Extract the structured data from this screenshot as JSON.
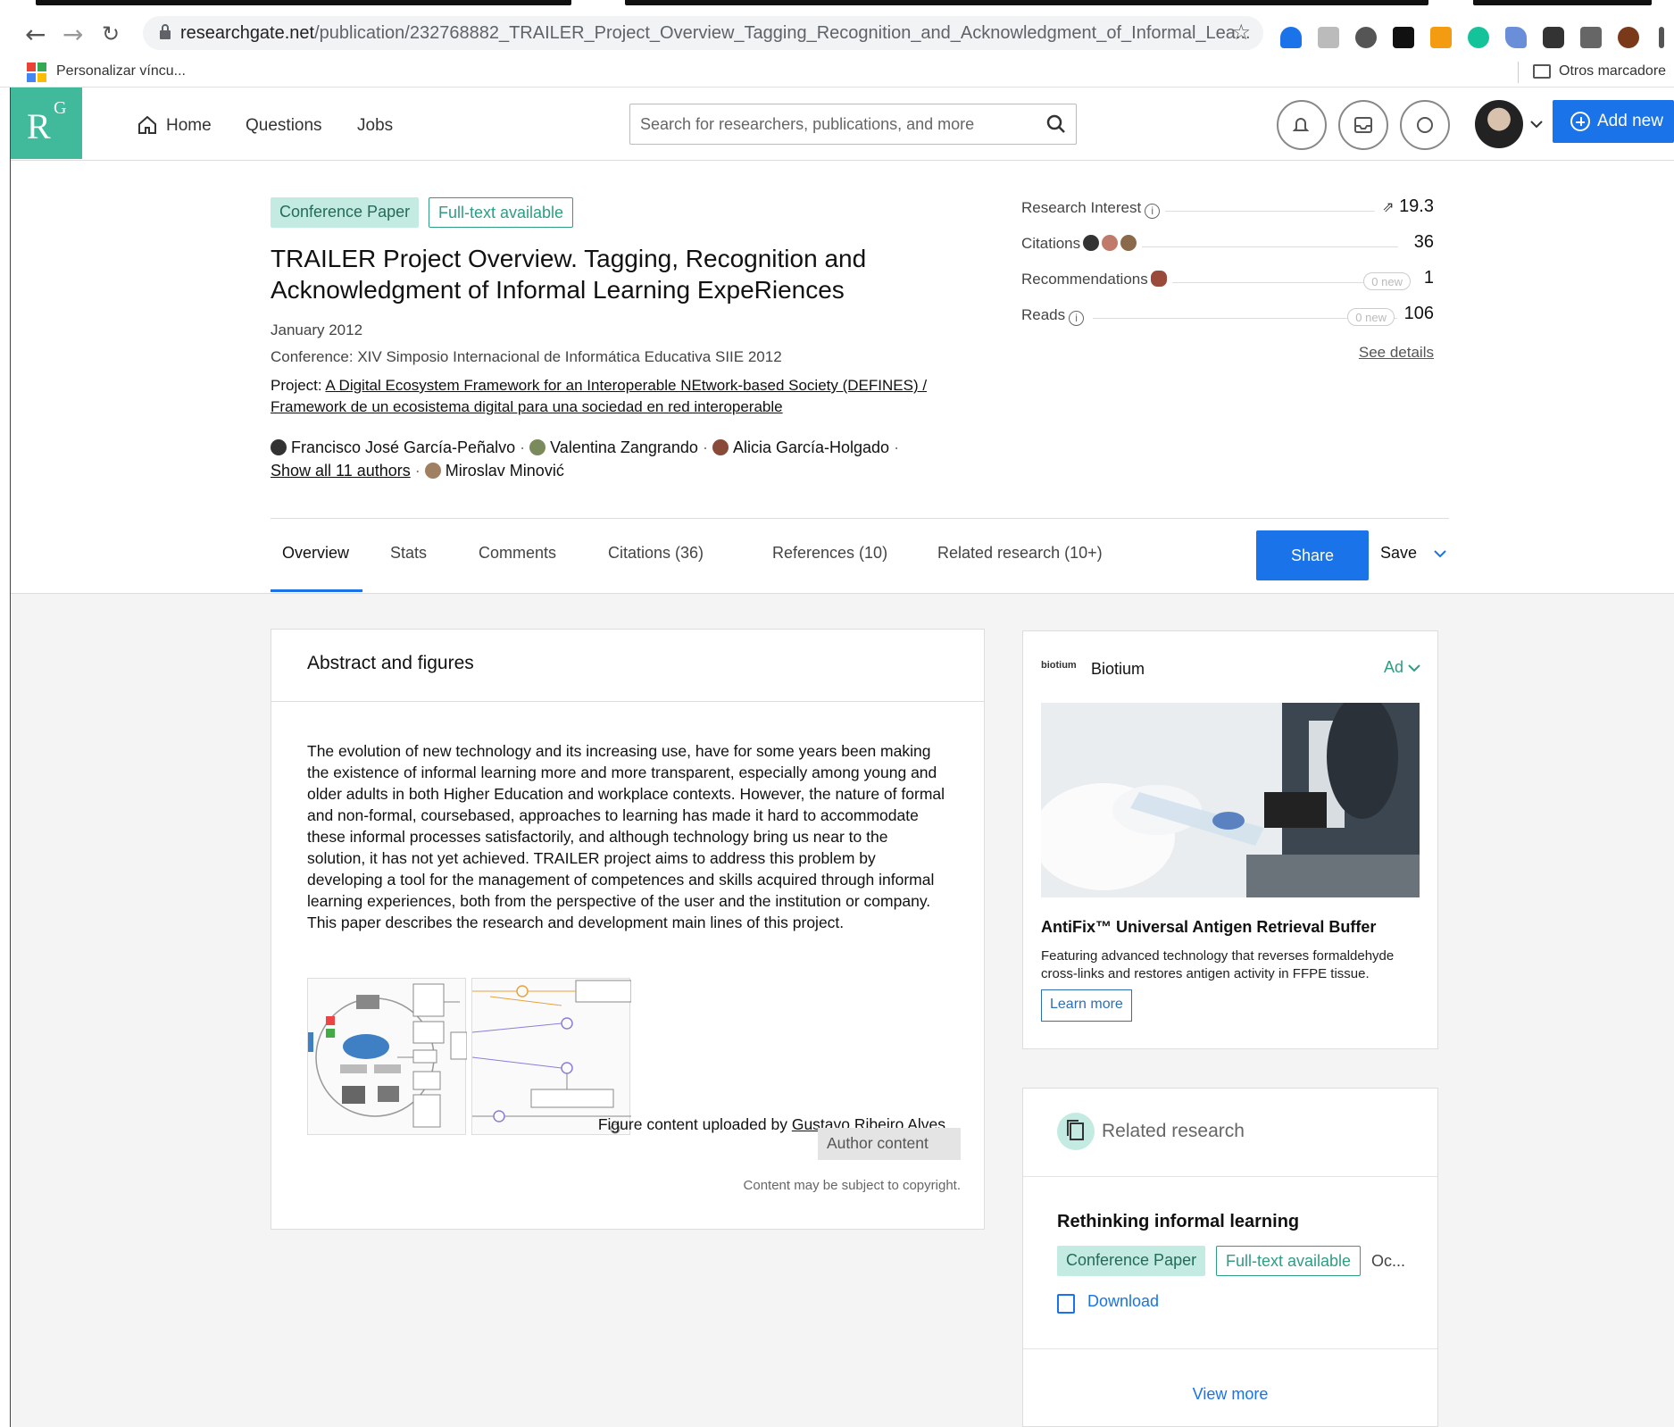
{
  "browser": {
    "url_domain": "researchgate.net",
    "url_path": "/publication/232768882_TRAILER_Project_Overview_Tagging_Recognition_and_Acknowledgment_of_Informal_Lea...",
    "bookmark_apps_label": "Personalizar víncu...",
    "bookmark_other": "Otros marcadore"
  },
  "header": {
    "logo_r": "R",
    "logo_g": "G",
    "nav": {
      "home": "Home",
      "questions": "Questions",
      "jobs": "Jobs"
    },
    "search_placeholder": "Search for researchers, publications, and more",
    "add_new": "Add new"
  },
  "publication": {
    "type_badge": "Conference Paper",
    "fulltext_badge": "Full-text available",
    "title": "TRAILER Project Overview. Tagging, Recognition and Acknowledgment of Informal Learning ExpeRiences",
    "date": "January 2012",
    "conference": "Conference: XIV Simposio Internacional de Informática Educativa SIIE 2012",
    "project_prefix": "Project: ",
    "project_link": "A Digital Ecosystem Framework for an Interoperable NEtwork-based Society (DEFINES) / Framework de un ecosistema digital para una sociedad en red interoperable",
    "authors": [
      "Francisco José García-Peñalvo",
      "Valentina Zangrando",
      "Alicia García-Holgado"
    ],
    "show_all_authors": "Show all 11 authors",
    "last_author": "Miroslav Minović",
    "separator": "·"
  },
  "stats": {
    "research_interest": {
      "label": "Research Interest",
      "value": "19.3"
    },
    "citations": {
      "label": "Citations",
      "value": "36"
    },
    "recommendations": {
      "label": "Recommendations",
      "new": "0 new",
      "value": "1"
    },
    "reads": {
      "label": "Reads",
      "new": "0 new",
      "value": "106"
    },
    "see_details": "See details",
    "info_glyph": "i"
  },
  "tabs": {
    "overview": "Overview",
    "stats": "Stats",
    "comments": "Comments",
    "citations": "Citations (36)",
    "references": "References (10)",
    "related": "Related research (10+)",
    "share": "Share",
    "save": "Save"
  },
  "abstract": {
    "heading": "Abstract and figures",
    "text": "The evolution of new technology and its increasing use, have for some years been making the existence of informal learning more and more transparent, especially among young and older adults in both Higher Education and workplace contexts. However, the nature of formal and non-formal, coursebased, approaches to learning has made it hard to accommodate these informal processes satisfactorily, and although technology bring us near to the solution, it has not yet achieved. TRAILER project aims to address this problem by developing a tool for the management of competences and skills acquired through informal learning experiences, both from the perspective of the user and the institution or company. This paper describes the research and development main lines of this project.",
    "figure_caption_prefix": "Figure content uploaded by ",
    "figure_uploader": "Gustavo Ribeiro Alves",
    "author_content": "Author content",
    "copyright": "Content may be subject to copyright."
  },
  "ad": {
    "logo": "biotium",
    "brand": "Biotium",
    "tag": "Ad",
    "title": "AntiFix™ Universal Antigen Retrieval Buffer",
    "description": "Featuring advanced technology that reverses formaldehyde cross-links and restores antigen activity in FFPE tissue.",
    "cta": "Learn more"
  },
  "related": {
    "heading": "Related research",
    "item_title": "Rethinking informal learning",
    "item_type": "Conference Paper",
    "item_fulltext": "Full-text available",
    "item_date_trunc": "Oc...",
    "download": "Download",
    "view_more": "View more"
  },
  "colors": {
    "brand": "#40ba9b",
    "primary": "#1a73e8",
    "page_bg": "#f4f4f4"
  }
}
